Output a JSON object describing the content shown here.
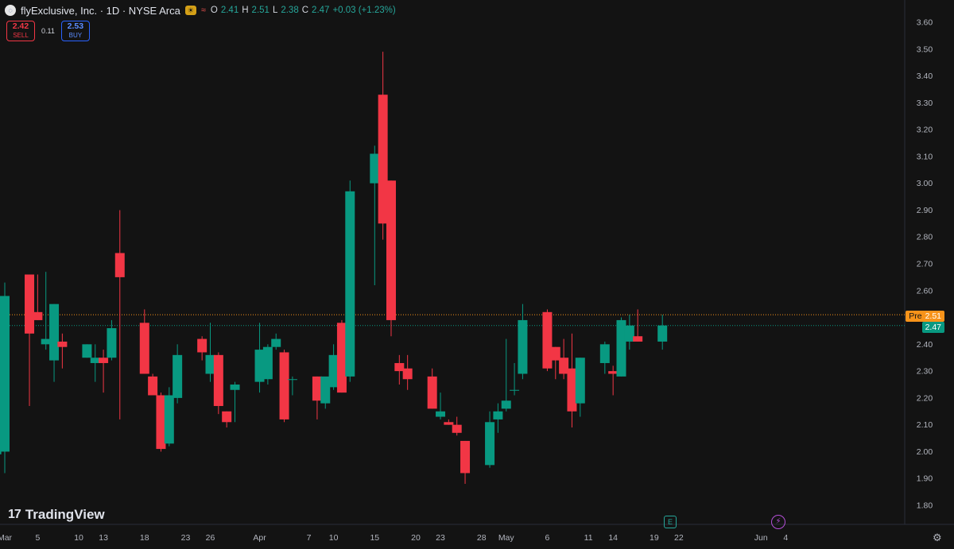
{
  "header": {
    "symbol_title": "flyExclusive, Inc. · 1D · NYSE Arca",
    "logo_glyph": "◌",
    "ohlc": {
      "o_label": "O",
      "o_value": "2.41",
      "h_label": "H",
      "h_value": "2.51",
      "l_label": "L",
      "l_value": "2.38",
      "c_label": "C",
      "c_value": "2.47",
      "change": "+0.03 (+1.23%)"
    }
  },
  "trade": {
    "sell_price": "2.42",
    "sell_label": "SELL",
    "spread": "0.11",
    "buy_price": "2.53",
    "buy_label": "BUY"
  },
  "branding": {
    "name": "TradingView",
    "mark": "17"
  },
  "price_tags": {
    "pre_label": "Pre",
    "pre_value": "2.51",
    "last_value": "2.47"
  },
  "events": {
    "earnings": "E",
    "dividend": "⚡"
  },
  "colors": {
    "up": "#089981",
    "down": "#f23645",
    "background": "#131313",
    "pre": "#f7931a"
  },
  "chart_data": {
    "type": "candlestick",
    "y_range": [
      1.75,
      3.62
    ],
    "y_ticks": [
      "3.60",
      "3.50",
      "3.40",
      "3.30",
      "3.20",
      "3.10",
      "3.00",
      "2.90",
      "2.80",
      "2.70",
      "2.60",
      "2.50",
      "2.40",
      "2.30",
      "2.20",
      "2.10",
      "2.00",
      "1.90",
      "1.80"
    ],
    "x_ticks": [
      {
        "label": "Mar",
        "date": "2024-03-01"
      },
      {
        "label": "5",
        "date": "2024-03-05"
      },
      {
        "label": "10",
        "date": "2024-03-10"
      },
      {
        "label": "13",
        "date": "2024-03-13"
      },
      {
        "label": "18",
        "date": "2024-03-18"
      },
      {
        "label": "23",
        "date": "2024-03-23"
      },
      {
        "label": "26",
        "date": "2024-03-26"
      },
      {
        "label": "Apr",
        "date": "2024-04-01"
      },
      {
        "label": "7",
        "date": "2024-04-07"
      },
      {
        "label": "10",
        "date": "2024-04-10"
      },
      {
        "label": "15",
        "date": "2024-04-15"
      },
      {
        "label": "20",
        "date": "2024-04-20"
      },
      {
        "label": "23",
        "date": "2024-04-23"
      },
      {
        "label": "28",
        "date": "2024-04-28"
      },
      {
        "label": "May",
        "date": "2024-05-01"
      },
      {
        "label": "6",
        "date": "2024-05-06"
      },
      {
        "label": "11",
        "date": "2024-05-11"
      },
      {
        "label": "14",
        "date": "2024-05-14"
      },
      {
        "label": "19",
        "date": "2024-05-19"
      },
      {
        "label": "22",
        "date": "2024-05-22"
      },
      {
        "label": "Jun",
        "date": "2024-06-01"
      },
      {
        "label": "4",
        "date": "2024-06-04"
      }
    ],
    "pre_market_price": 2.51,
    "last_price": 2.47,
    "candles": [
      {
        "d": "2024-02-29",
        "o": 1.99,
        "h": 2.06,
        "l": 1.98,
        "c": 2.01
      },
      {
        "d": "2024-03-01",
        "o": 2.0,
        "h": 2.63,
        "l": 1.92,
        "c": 2.58
      },
      {
        "d": "2024-03-04",
        "o": 2.66,
        "h": 2.66,
        "l": 2.17,
        "c": 2.44
      },
      {
        "d": "2024-03-05",
        "o": 2.52,
        "h": 2.66,
        "l": 2.49,
        "c": 2.49
      },
      {
        "d": "2024-03-06",
        "o": 2.4,
        "h": 2.67,
        "l": 2.38,
        "c": 2.42
      },
      {
        "d": "2024-03-07",
        "o": 2.34,
        "h": 2.55,
        "l": 2.26,
        "c": 2.55
      },
      {
        "d": "2024-03-08",
        "o": 2.41,
        "h": 2.44,
        "l": 2.31,
        "c": 2.39
      },
      {
        "d": "2024-03-11",
        "o": 2.35,
        "h": 2.4,
        "l": 2.35,
        "c": 2.4
      },
      {
        "d": "2024-03-12",
        "o": 2.33,
        "h": 2.4,
        "l": 2.26,
        "c": 2.35
      },
      {
        "d": "2024-03-13",
        "o": 2.35,
        "h": 2.38,
        "l": 2.22,
        "c": 2.33
      },
      {
        "d": "2024-03-14",
        "o": 2.35,
        "h": 2.49,
        "l": 2.34,
        "c": 2.46
      },
      {
        "d": "2024-03-15",
        "o": 2.74,
        "h": 2.9,
        "l": 2.12,
        "c": 2.65
      },
      {
        "d": "2024-03-18",
        "o": 2.48,
        "h": 2.53,
        "l": 2.29,
        "c": 2.29
      },
      {
        "d": "2024-03-19",
        "o": 2.28,
        "h": 2.29,
        "l": 2.21,
        "c": 2.21
      },
      {
        "d": "2024-03-20",
        "o": 2.21,
        "h": 2.22,
        "l": 2.0,
        "c": 2.01
      },
      {
        "d": "2024-03-21",
        "o": 2.03,
        "h": 2.24,
        "l": 2.02,
        "c": 2.21
      },
      {
        "d": "2024-03-22",
        "o": 2.2,
        "h": 2.4,
        "l": 2.18,
        "c": 2.36
      },
      {
        "d": "2024-03-25",
        "o": 2.42,
        "h": 2.43,
        "l": 2.34,
        "c": 2.37
      },
      {
        "d": "2024-03-26",
        "o": 2.29,
        "h": 2.48,
        "l": 2.26,
        "c": 2.36
      },
      {
        "d": "2024-03-27",
        "o": 2.36,
        "h": 2.37,
        "l": 2.14,
        "c": 2.17
      },
      {
        "d": "2024-03-28",
        "o": 2.15,
        "h": 2.15,
        "l": 2.09,
        "c": 2.11
      },
      {
        "d": "2024-03-29",
        "o": 2.23,
        "h": 2.26,
        "l": 2.11,
        "c": 2.25
      },
      {
        "d": "2024-04-01",
        "o": 2.26,
        "h": 2.48,
        "l": 2.22,
        "c": 2.38
      },
      {
        "d": "2024-04-02",
        "o": 2.27,
        "h": 2.4,
        "l": 2.25,
        "c": 2.39
      },
      {
        "d": "2024-04-03",
        "o": 2.39,
        "h": 2.44,
        "l": 2.38,
        "c": 2.42
      },
      {
        "d": "2024-04-04",
        "o": 2.37,
        "h": 2.38,
        "l": 2.11,
        "c": 2.12
      },
      {
        "d": "2024-04-05",
        "o": 2.27,
        "h": 2.28,
        "l": 2.21,
        "c": 2.27
      },
      {
        "d": "2024-04-08",
        "o": 2.28,
        "h": 2.28,
        "l": 2.12,
        "c": 2.19
      },
      {
        "d": "2024-04-09",
        "o": 2.18,
        "h": 2.27,
        "l": 2.16,
        "c": 2.28
      },
      {
        "d": "2024-04-10",
        "o": 2.24,
        "h": 2.4,
        "l": 2.23,
        "c": 2.36
      },
      {
        "d": "2024-04-11",
        "o": 2.48,
        "h": 2.49,
        "l": 2.22,
        "c": 2.22
      },
      {
        "d": "2024-04-12",
        "o": 2.28,
        "h": 3.01,
        "l": 2.26,
        "c": 2.97
      },
      {
        "d": "2024-04-15",
        "o": 3.0,
        "h": 3.14,
        "l": 2.62,
        "c": 3.11
      },
      {
        "d": "2024-04-16",
        "o": 3.33,
        "h": 3.49,
        "l": 2.79,
        "c": 2.85
      },
      {
        "d": "2024-04-17",
        "o": 3.01,
        "h": 3.01,
        "l": 2.43,
        "c": 2.49
      },
      {
        "d": "2024-04-18",
        "o": 2.33,
        "h": 2.36,
        "l": 2.25,
        "c": 2.3
      },
      {
        "d": "2024-04-19",
        "o": 2.31,
        "h": 2.36,
        "l": 2.23,
        "c": 2.27
      },
      {
        "d": "2024-04-22",
        "o": 2.28,
        "h": 2.31,
        "l": 2.16,
        "c": 2.16
      },
      {
        "d": "2024-04-23",
        "o": 2.13,
        "h": 2.22,
        "l": 2.12,
        "c": 2.15
      },
      {
        "d": "2024-04-24",
        "o": 2.11,
        "h": 2.12,
        "l": 2.1,
        "c": 2.1
      },
      {
        "d": "2024-04-25",
        "o": 2.1,
        "h": 2.13,
        "l": 2.06,
        "c": 2.07
      },
      {
        "d": "2024-04-26",
        "o": 2.04,
        "h": 2.04,
        "l": 1.88,
        "c": 1.92
      },
      {
        "d": "2024-04-29",
        "o": 1.95,
        "h": 2.15,
        "l": 1.94,
        "c": 2.11
      },
      {
        "d": "2024-04-30",
        "o": 2.12,
        "h": 2.18,
        "l": 2.07,
        "c": 2.15
      },
      {
        "d": "2024-05-01",
        "o": 2.16,
        "h": 2.42,
        "l": 2.15,
        "c": 2.19
      },
      {
        "d": "2024-05-02",
        "o": 2.23,
        "h": 2.33,
        "l": 2.21,
        "c": 2.23
      },
      {
        "d": "2024-05-03",
        "o": 2.29,
        "h": 2.55,
        "l": 2.27,
        "c": 2.49
      },
      {
        "d": "2024-05-06",
        "o": 2.52,
        "h": 2.53,
        "l": 2.3,
        "c": 2.31
      },
      {
        "d": "2024-05-07",
        "o": 2.39,
        "h": 2.39,
        "l": 2.27,
        "c": 2.34
      },
      {
        "d": "2024-05-08",
        "o": 2.35,
        "h": 2.42,
        "l": 2.27,
        "c": 2.29
      },
      {
        "d": "2024-05-09",
        "o": 2.31,
        "h": 2.44,
        "l": 2.09,
        "c": 2.15
      },
      {
        "d": "2024-05-10",
        "o": 2.18,
        "h": 2.35,
        "l": 2.13,
        "c": 2.35
      },
      {
        "d": "2024-05-13",
        "o": 2.33,
        "h": 2.41,
        "l": 2.29,
        "c": 2.4
      },
      {
        "d": "2024-05-14",
        "o": 2.3,
        "h": 2.32,
        "l": 2.21,
        "c": 2.29
      },
      {
        "d": "2024-05-15",
        "o": 2.28,
        "h": 2.5,
        "l": 2.28,
        "c": 2.49
      },
      {
        "d": "2024-05-16",
        "o": 2.41,
        "h": 2.51,
        "l": 2.38,
        "c": 2.47
      },
      {
        "d": "2024-05-17",
        "o": 2.43,
        "h": 2.53,
        "l": 2.41,
        "c": 2.41
      },
      {
        "d": "2024-05-20",
        "o": 2.41,
        "h": 2.51,
        "l": 2.38,
        "c": 2.47
      }
    ]
  }
}
